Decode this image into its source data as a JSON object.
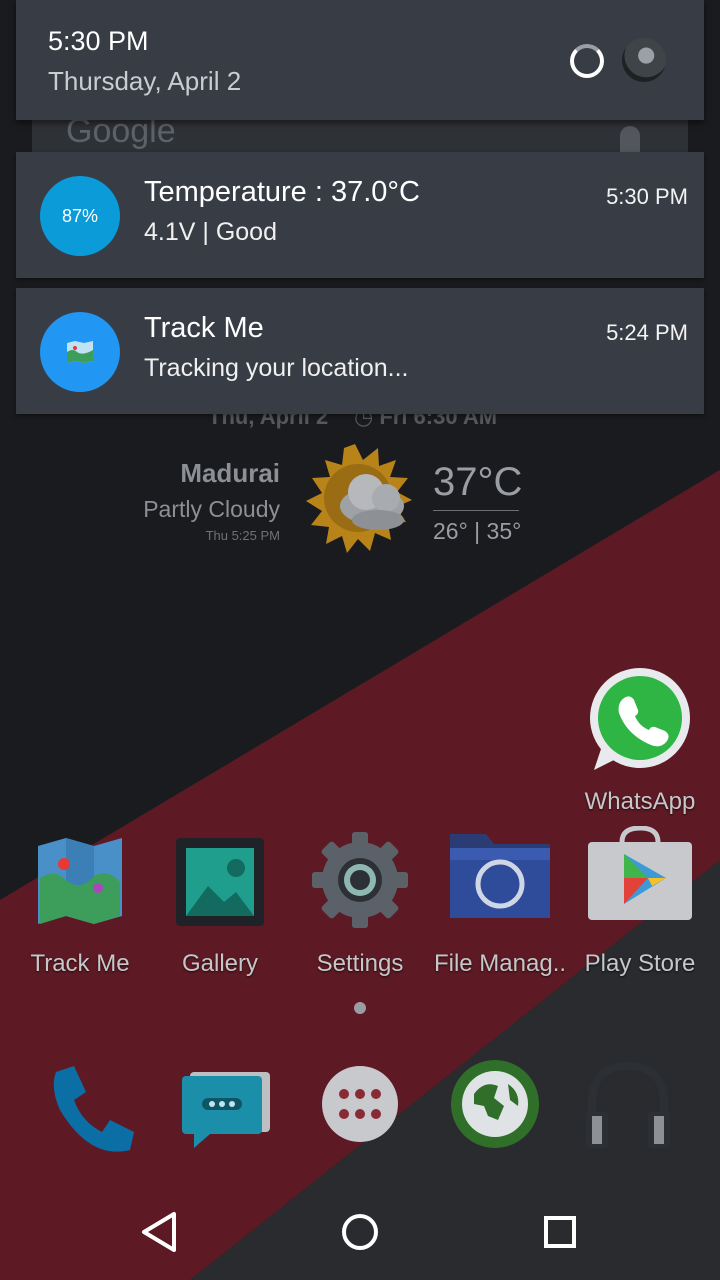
{
  "status": {
    "time": "5:30 PM",
    "date": "Thursday, April 2"
  },
  "search_peek": {
    "text": "Google"
  },
  "notifications": [
    {
      "percent": "87%",
      "title": "Temperature : 37.0°C",
      "subtitle": "4.1V  | Good",
      "time": "5:30 PM",
      "icon_color": "#0b9bd8"
    },
    {
      "title": "Track Me",
      "subtitle": "Tracking your location...",
      "time": "5:24 PM",
      "icon_color": "#2196f3"
    }
  ],
  "weather": {
    "date": "Thu, April 2",
    "alarm": "Fri 6:30 AM",
    "city": "Madurai",
    "condition": "Partly Cloudy",
    "updated": "Thu 5:25 PM",
    "temperature": "37°C",
    "range": "26° | 35°"
  },
  "apps": [
    {
      "label": "WhatsApp",
      "icon": "whatsapp-icon"
    },
    {
      "label": "Track Me",
      "icon": "map-icon"
    },
    {
      "label": "Gallery",
      "icon": "gallery-icon"
    },
    {
      "label": "Settings",
      "icon": "gear-icon"
    },
    {
      "label": "File Manag..",
      "icon": "folder-icon"
    },
    {
      "label": "Play Store",
      "icon": "play-store-icon"
    }
  ],
  "dock": [
    {
      "icon": "phone-icon"
    },
    {
      "icon": "messaging-icon"
    },
    {
      "icon": "app-drawer-icon"
    },
    {
      "icon": "browser-globe-icon"
    },
    {
      "icon": "headphones-icon"
    }
  ],
  "colors": {
    "panel": "#373c45",
    "accent_red": "#5a1822",
    "wallpaper_dark": "#1a1b1e"
  }
}
